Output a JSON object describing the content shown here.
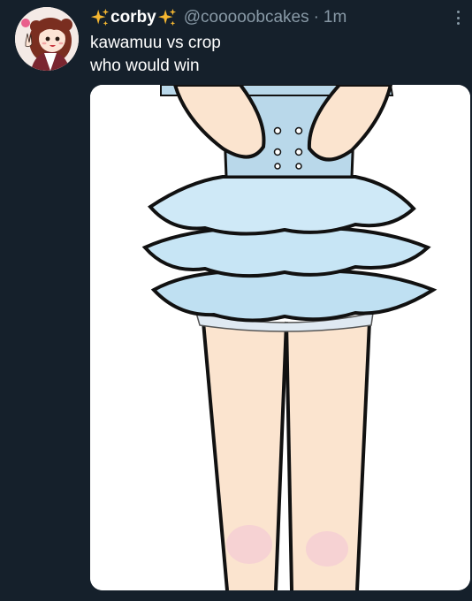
{
  "tweet": {
    "display_name": "corby",
    "handle": "@cooooobcakes",
    "separator": "·",
    "time": "1m",
    "text_lines": [
      "kawamuu vs crop",
      "who would win"
    ],
    "avatar_icon": "girl-avatar-icon",
    "media_icon": "drawing-image"
  },
  "colors": {
    "background": "#15202b",
    "secondary_text": "#8899a6",
    "primary_text": "#ffffff",
    "sparkle": "#f5b731"
  }
}
